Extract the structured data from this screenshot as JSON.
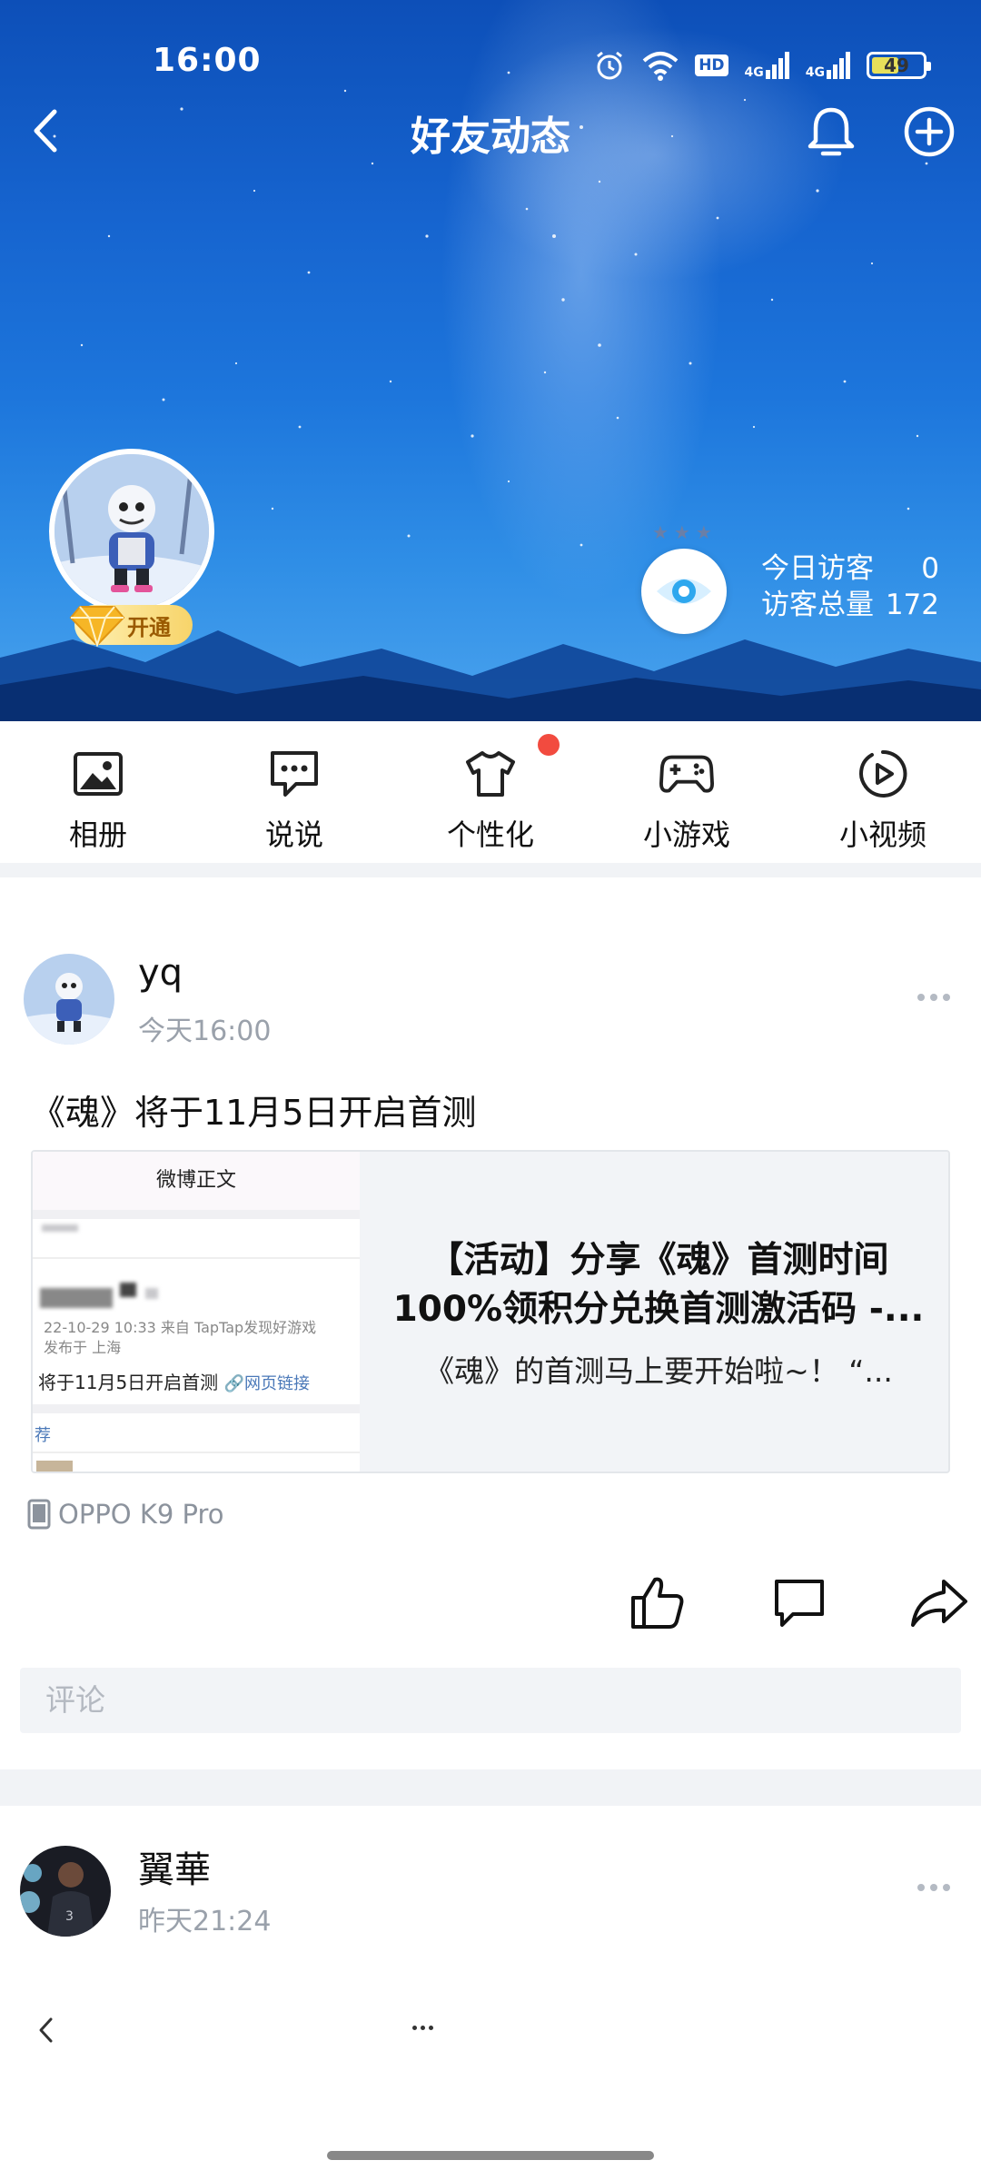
{
  "status_bar": {
    "time": "16:00",
    "hd_label": "HD",
    "network_1": "4G",
    "network_2": "4G",
    "battery": "49",
    "battery_level": 0.49,
    "battery_color": "#e7e05a",
    "icons": [
      "alarm-icon",
      "wifi-icon",
      "hd-icon",
      "signal-icon",
      "signal-icon",
      "battery-icon"
    ]
  },
  "nav": {
    "title": "好友动态",
    "back_icon": "chevron-left-icon",
    "bell_icon": "bell-icon",
    "add_icon": "plus-circle-icon"
  },
  "profile": {
    "vip_label": "开通",
    "visitors": {
      "today_label": "今日访客",
      "today_value": "0",
      "total_label": "访客总量",
      "total_value": "172"
    }
  },
  "quick_menu": [
    {
      "label": "相册",
      "icon": "photo-album-icon"
    },
    {
      "label": "说说",
      "icon": "chat-bubble-icon"
    },
    {
      "label": "个性化",
      "icon": "tshirt-icon",
      "badge": true
    },
    {
      "label": "小游戏",
      "icon": "gamepad-icon"
    },
    {
      "label": "小视频",
      "icon": "play-circle-icon"
    }
  ],
  "posts": [
    {
      "author": "yq",
      "time": "今天16:00",
      "text": "《魂》将于11月5日开启首测",
      "link": {
        "thumb_header": "微博正文",
        "thumb_meta_1": "22-10-29 10:33  来自 TapTap发现好游戏",
        "thumb_meta_2": "发布于 上海",
        "thumb_text": "将于11月5日开启首测",
        "thumb_link": "🔗网页链接",
        "thumb_rec": "荐",
        "title_line1": "【活动】分享《魂》首测时间",
        "title_line2": "100%领积分兑换首测激活码 -...",
        "desc": "《魂》的首测马上要开始啦~！ “..."
      },
      "device": "OPPO K9 Pro",
      "comment_placeholder": "评论"
    },
    {
      "author": "翼華",
      "time": "昨天21:24"
    }
  ],
  "colors": {
    "accent_blue": "#1d76dc",
    "badge_red": "#f24b3f",
    "secondary_text": "#9aa1ab"
  }
}
